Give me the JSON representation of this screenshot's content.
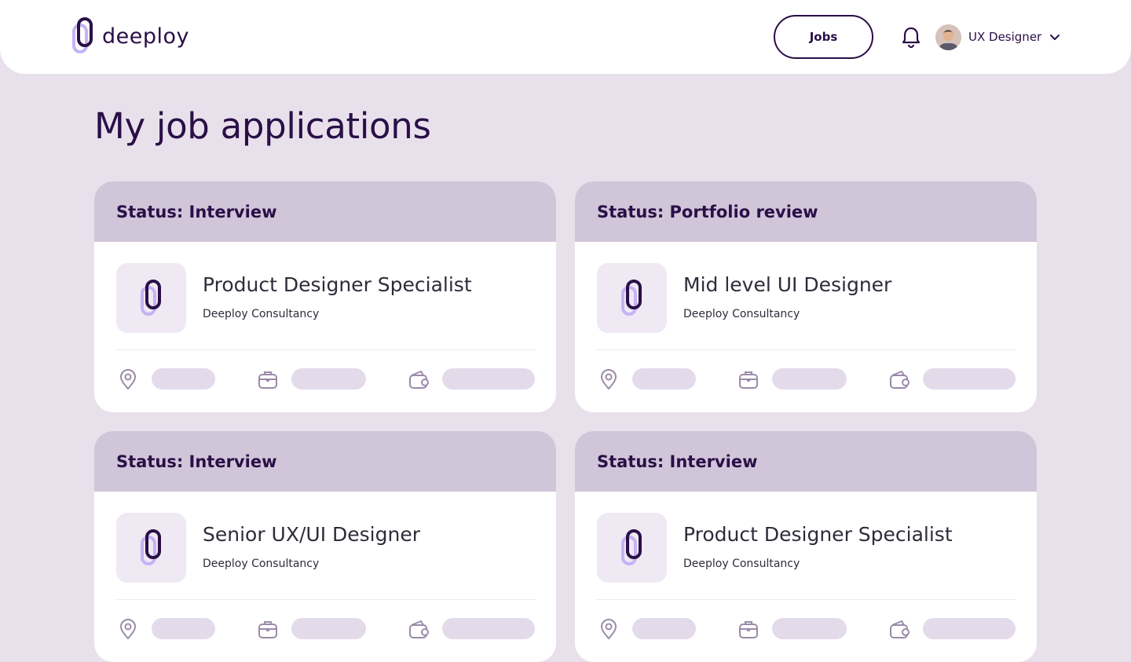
{
  "header": {
    "brand_name": "deeploy",
    "jobs_label": "Jobs",
    "profile_name": "UX Designer",
    "icons": [
      "deeploy-logo-icon",
      "bell-icon",
      "chevron-down-icon"
    ]
  },
  "page": {
    "title": "My job applications"
  },
  "colors": {
    "brand": "#2a0f47",
    "accent_light": "#b8a3f0",
    "background": "#e8e1ec",
    "status_bar": "#d0c5d9",
    "placeholder": "#e3dbea"
  },
  "applications": [
    {
      "status": "Status: Interview",
      "title": "Product Designer Specialist",
      "company": "Deeploy Consultancy"
    },
    {
      "status": "Status: Portfolio review",
      "title": "Mid level UI Designer",
      "company": "Deeploy Consultancy"
    },
    {
      "status": "Status: Interview",
      "title": "Senior UX/UI Designer",
      "company": "Deeploy Consultancy"
    },
    {
      "status": "Status: Interview",
      "title": "Product Designer Specialist",
      "company": "Deeploy Consultancy"
    }
  ],
  "card_meta_icons": [
    "location-pin-icon",
    "briefcase-icon",
    "wallet-icon"
  ]
}
